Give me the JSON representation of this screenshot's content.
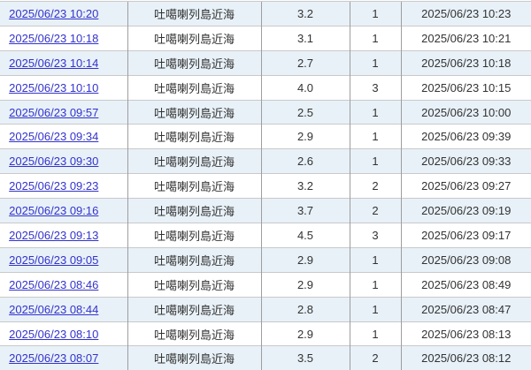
{
  "colors": {
    "row_alt_bg": "#e8f1f8",
    "link": "#3333cc",
    "text": "#333333",
    "border_horizontal": "#c9c9c9",
    "border_vertical": "#9e9e9e",
    "page_bg": "#ffffff"
  },
  "table": {
    "rows": [
      {
        "detected": "2025/06/23 10:20",
        "epicenter": "吐噶喇列島近海",
        "magnitude": "3.2",
        "max_intensity": "1",
        "announced": "2025/06/23 10:23"
      },
      {
        "detected": "2025/06/23 10:18",
        "epicenter": "吐噶喇列島近海",
        "magnitude": "3.1",
        "max_intensity": "1",
        "announced": "2025/06/23 10:21"
      },
      {
        "detected": "2025/06/23 10:14",
        "epicenter": "吐噶喇列島近海",
        "magnitude": "2.7",
        "max_intensity": "1",
        "announced": "2025/06/23 10:18"
      },
      {
        "detected": "2025/06/23 10:10",
        "epicenter": "吐噶喇列島近海",
        "magnitude": "4.0",
        "max_intensity": "3",
        "announced": "2025/06/23 10:15"
      },
      {
        "detected": "2025/06/23 09:57",
        "epicenter": "吐噶喇列島近海",
        "magnitude": "2.5",
        "max_intensity": "1",
        "announced": "2025/06/23 10:00"
      },
      {
        "detected": "2025/06/23 09:34",
        "epicenter": "吐噶喇列島近海",
        "magnitude": "2.9",
        "max_intensity": "1",
        "announced": "2025/06/23 09:39"
      },
      {
        "detected": "2025/06/23 09:30",
        "epicenter": "吐噶喇列島近海",
        "magnitude": "2.6",
        "max_intensity": "1",
        "announced": "2025/06/23 09:33"
      },
      {
        "detected": "2025/06/23 09:23",
        "epicenter": "吐噶喇列島近海",
        "magnitude": "3.2",
        "max_intensity": "2",
        "announced": "2025/06/23 09:27"
      },
      {
        "detected": "2025/06/23 09:16",
        "epicenter": "吐噶喇列島近海",
        "magnitude": "3.7",
        "max_intensity": "2",
        "announced": "2025/06/23 09:19"
      },
      {
        "detected": "2025/06/23 09:13",
        "epicenter": "吐噶喇列島近海",
        "magnitude": "4.5",
        "max_intensity": "3",
        "announced": "2025/06/23 09:17"
      },
      {
        "detected": "2025/06/23 09:05",
        "epicenter": "吐噶喇列島近海",
        "magnitude": "2.9",
        "max_intensity": "1",
        "announced": "2025/06/23 09:08"
      },
      {
        "detected": "2025/06/23 08:46",
        "epicenter": "吐噶喇列島近海",
        "magnitude": "2.9",
        "max_intensity": "1",
        "announced": "2025/06/23 08:49"
      },
      {
        "detected": "2025/06/23 08:44",
        "epicenter": "吐噶喇列島近海",
        "magnitude": "2.8",
        "max_intensity": "1",
        "announced": "2025/06/23 08:47"
      },
      {
        "detected": "2025/06/23 08:10",
        "epicenter": "吐噶喇列島近海",
        "magnitude": "2.9",
        "max_intensity": "1",
        "announced": "2025/06/23 08:13"
      },
      {
        "detected": "2025/06/23 08:07",
        "epicenter": "吐噶喇列島近海",
        "magnitude": "3.5",
        "max_intensity": "2",
        "announced": "2025/06/23 08:12"
      }
    ]
  }
}
